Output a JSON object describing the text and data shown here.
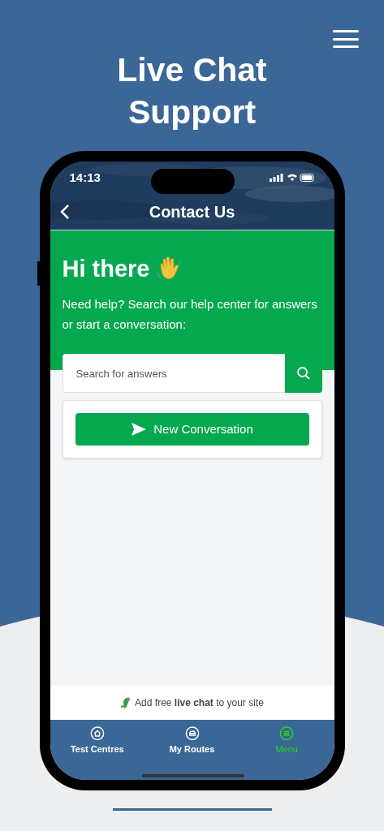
{
  "headline": "Live Chat Support",
  "status_bar": {
    "time": "14:13"
  },
  "header": {
    "title": "Contact Us"
  },
  "greeting": {
    "title": "Hi there",
    "message": "Need help? Search our help center for answers or start a conversation:"
  },
  "search": {
    "placeholder": "Search for answers"
  },
  "new_conversation_button": "New Conversation",
  "footer": "Add free **live chat** to your site",
  "tab_bar": [
    {
      "label": "Test Centres",
      "kind": "home",
      "selected": false
    },
    {
      "label": "My Routes",
      "kind": "car",
      "selected": false
    },
    {
      "label": "Menu",
      "kind": "menu",
      "selected": true
    }
  ]
}
